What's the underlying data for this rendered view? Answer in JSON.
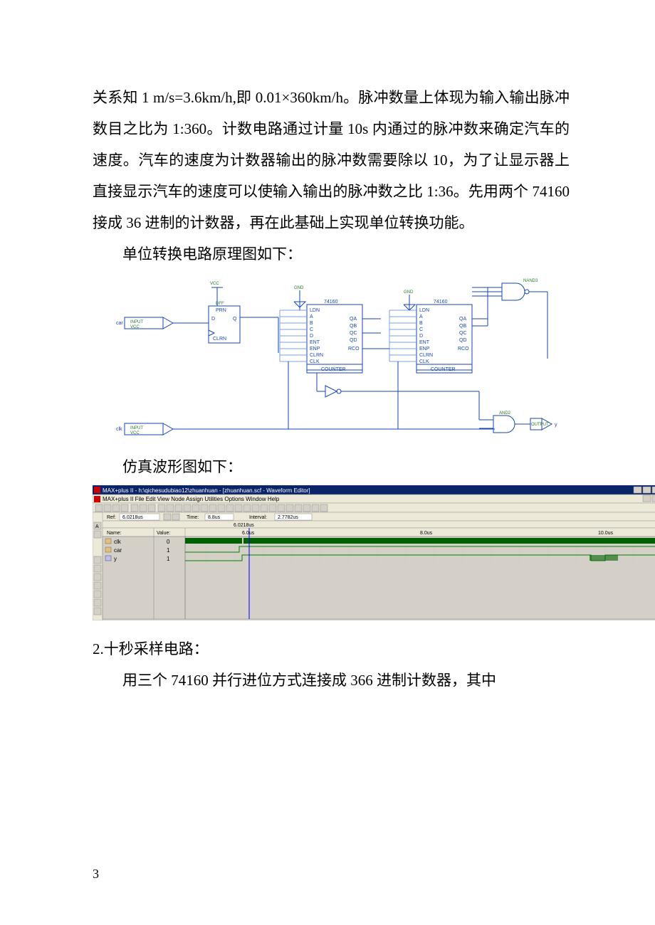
{
  "paragraphs": {
    "p1": "关系知 1 m/s=3.6km/h,即 0.01×360km/h。脉冲数量上体现为输入输出脉冲数目之比为 1:360。计数电路通过计量 10s 内通过的脉冲数来确定汽车的速度。汽车的速度为计数器输出的脉冲数需要除以 10，为了让显示器上直接显示汽车的速度可以使输入输出的脉冲数之比 1:36。先用两个 74160 接成 36 进制的计数器，再在此基础上实现单位转换功能。",
    "p2": "单位转换电路原理图如下：",
    "p3": "仿真波形图如下：",
    "h2": "2.十秒采样电路：",
    "p4": "用三个 74160 并行进位方式连接成 366 进制计数器，其中"
  },
  "circuit": {
    "chips": [
      "74160",
      "74160"
    ],
    "chip_block_label": "COUNTER",
    "chip_pins": [
      "LDN",
      "A",
      "B",
      "C",
      "D",
      "ENT",
      "ENP",
      "CLRN",
      "CLK"
    ],
    "chip_outs": [
      "QA",
      "QB",
      "QC",
      "QD",
      "RCO"
    ],
    "inputs": [
      {
        "name": "car",
        "buf": "INPUT",
        "rail": "VCC"
      },
      {
        "name": "clk",
        "buf": "INPUT",
        "rail": "VCC"
      }
    ],
    "output": {
      "name": "y",
      "buf": "OUTPUT"
    },
    "rails": [
      "VCC",
      "GND",
      "GND"
    ],
    "gate_labels": [
      "NAND3",
      "AND2"
    ],
    "ff_pins": [
      "PRN",
      "D",
      "Q",
      "CLRN"
    ],
    "ff_type": "DFF"
  },
  "waveform": {
    "app_title": "MAX+plus II - h:\\qichesudubiao12\\zhuanhuan - [zhuanhuan.scf - Waveform Editor]",
    "menubar": [
      "MAX+plus II",
      "File",
      "Edit",
      "View",
      "Node",
      "Assign",
      "Utilities",
      "Options",
      "Window",
      "Help"
    ],
    "ref_label": "Ref:",
    "ref_value": "6.0218us",
    "time_label": "Time:",
    "time_value": "8.8us",
    "interval_label": "Interval:",
    "interval_value": "2.7782us",
    "cursor_value": "6.0218us",
    "time_ticks": [
      "6.0us",
      "8.0us",
      "10.0us"
    ],
    "name_header": "Name:",
    "value_header": "Value:",
    "signals": [
      {
        "name": "clk",
        "value": "0"
      },
      {
        "name": "car",
        "value": "1"
      },
      {
        "name": "y",
        "value": "1"
      }
    ]
  },
  "pagenum": "3"
}
